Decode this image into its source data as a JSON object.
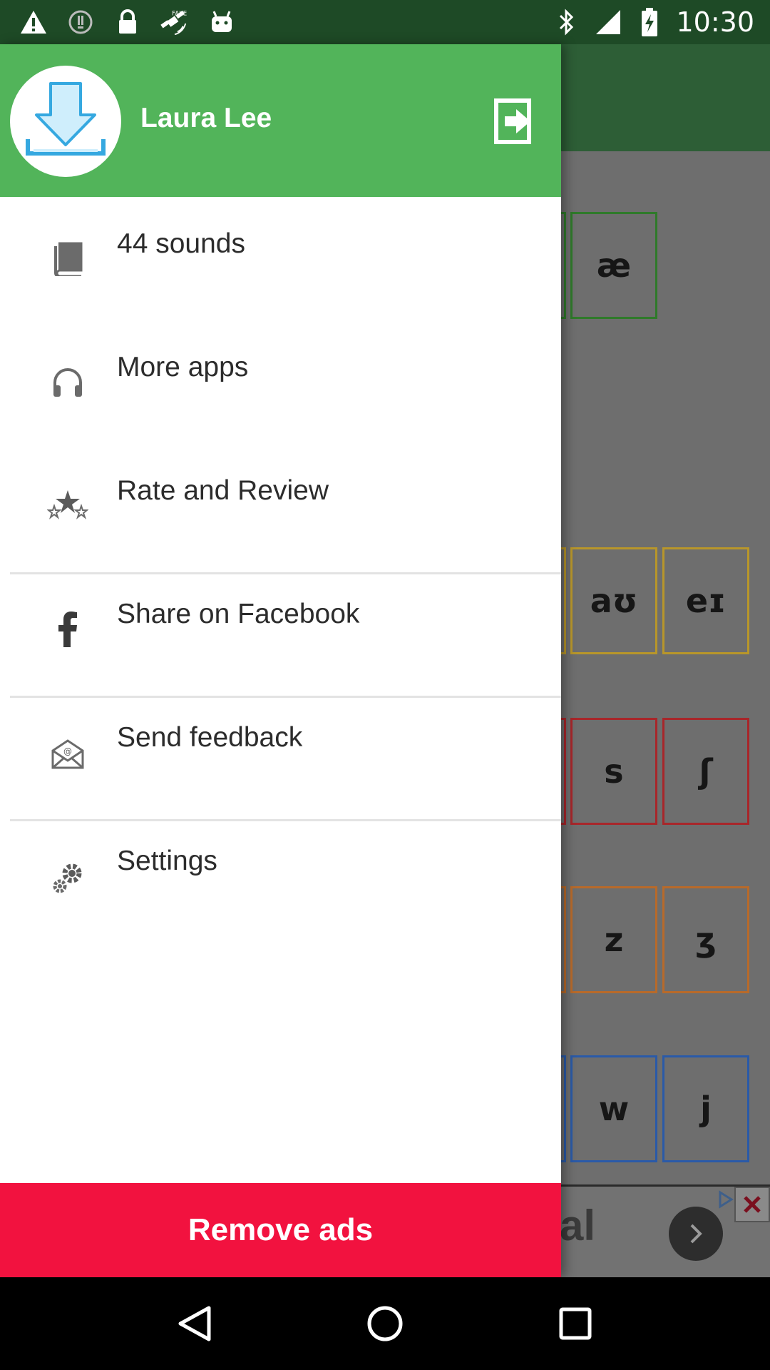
{
  "status_bar": {
    "time": "10:30",
    "left_icons": [
      "warning-icon",
      "alert-circle-icon",
      "lock-icon",
      "fake-gps-icon",
      "android-icon"
    ],
    "right_icons": [
      "bluetooth-icon",
      "signal-icon",
      "battery-charging-icon"
    ]
  },
  "drawer": {
    "header": {
      "user_name": "Laura Lee",
      "avatar_icon": "download-icon",
      "logout_icon": "logout-icon"
    },
    "items": [
      {
        "label": "44 sounds",
        "icon": "book-icon"
      },
      {
        "label": "More apps",
        "icon": "headphones-icon"
      },
      {
        "label": "Rate and Review",
        "icon": "stars-icon"
      },
      {
        "label": "Share on Facebook",
        "icon": "facebook-icon"
      },
      {
        "label": "Send feedback",
        "icon": "mail-icon"
      },
      {
        "label": "Settings",
        "icon": "settings-icon"
      }
    ],
    "remove_ads_label": "Remove ads"
  },
  "background": {
    "tiles": [
      {
        "symbol": "æ",
        "color": "#2f7a2a"
      },
      {
        "symbol": "aʊ",
        "color": "#b8962a"
      },
      {
        "symbol": "eɪ",
        "color": "#b8962a"
      },
      {
        "symbol": "s",
        "color": "#a8262a"
      },
      {
        "symbol": "ʃ",
        "color": "#a8262a"
      },
      {
        "symbol": "z",
        "color": "#b86a2a"
      },
      {
        "symbol": "ʒ",
        "color": "#b86a2a"
      },
      {
        "symbol": "w",
        "color": "#2a5aa8"
      },
      {
        "symbol": "j",
        "color": "#2a5aa8"
      }
    ],
    "ad_text": "al"
  },
  "colors": {
    "header_green": "#52b45a",
    "remove_ads_red": "#f2123f",
    "status_bar": "#1e4a26"
  },
  "nav": {
    "buttons": [
      "back-icon",
      "home-icon",
      "recents-icon"
    ]
  }
}
